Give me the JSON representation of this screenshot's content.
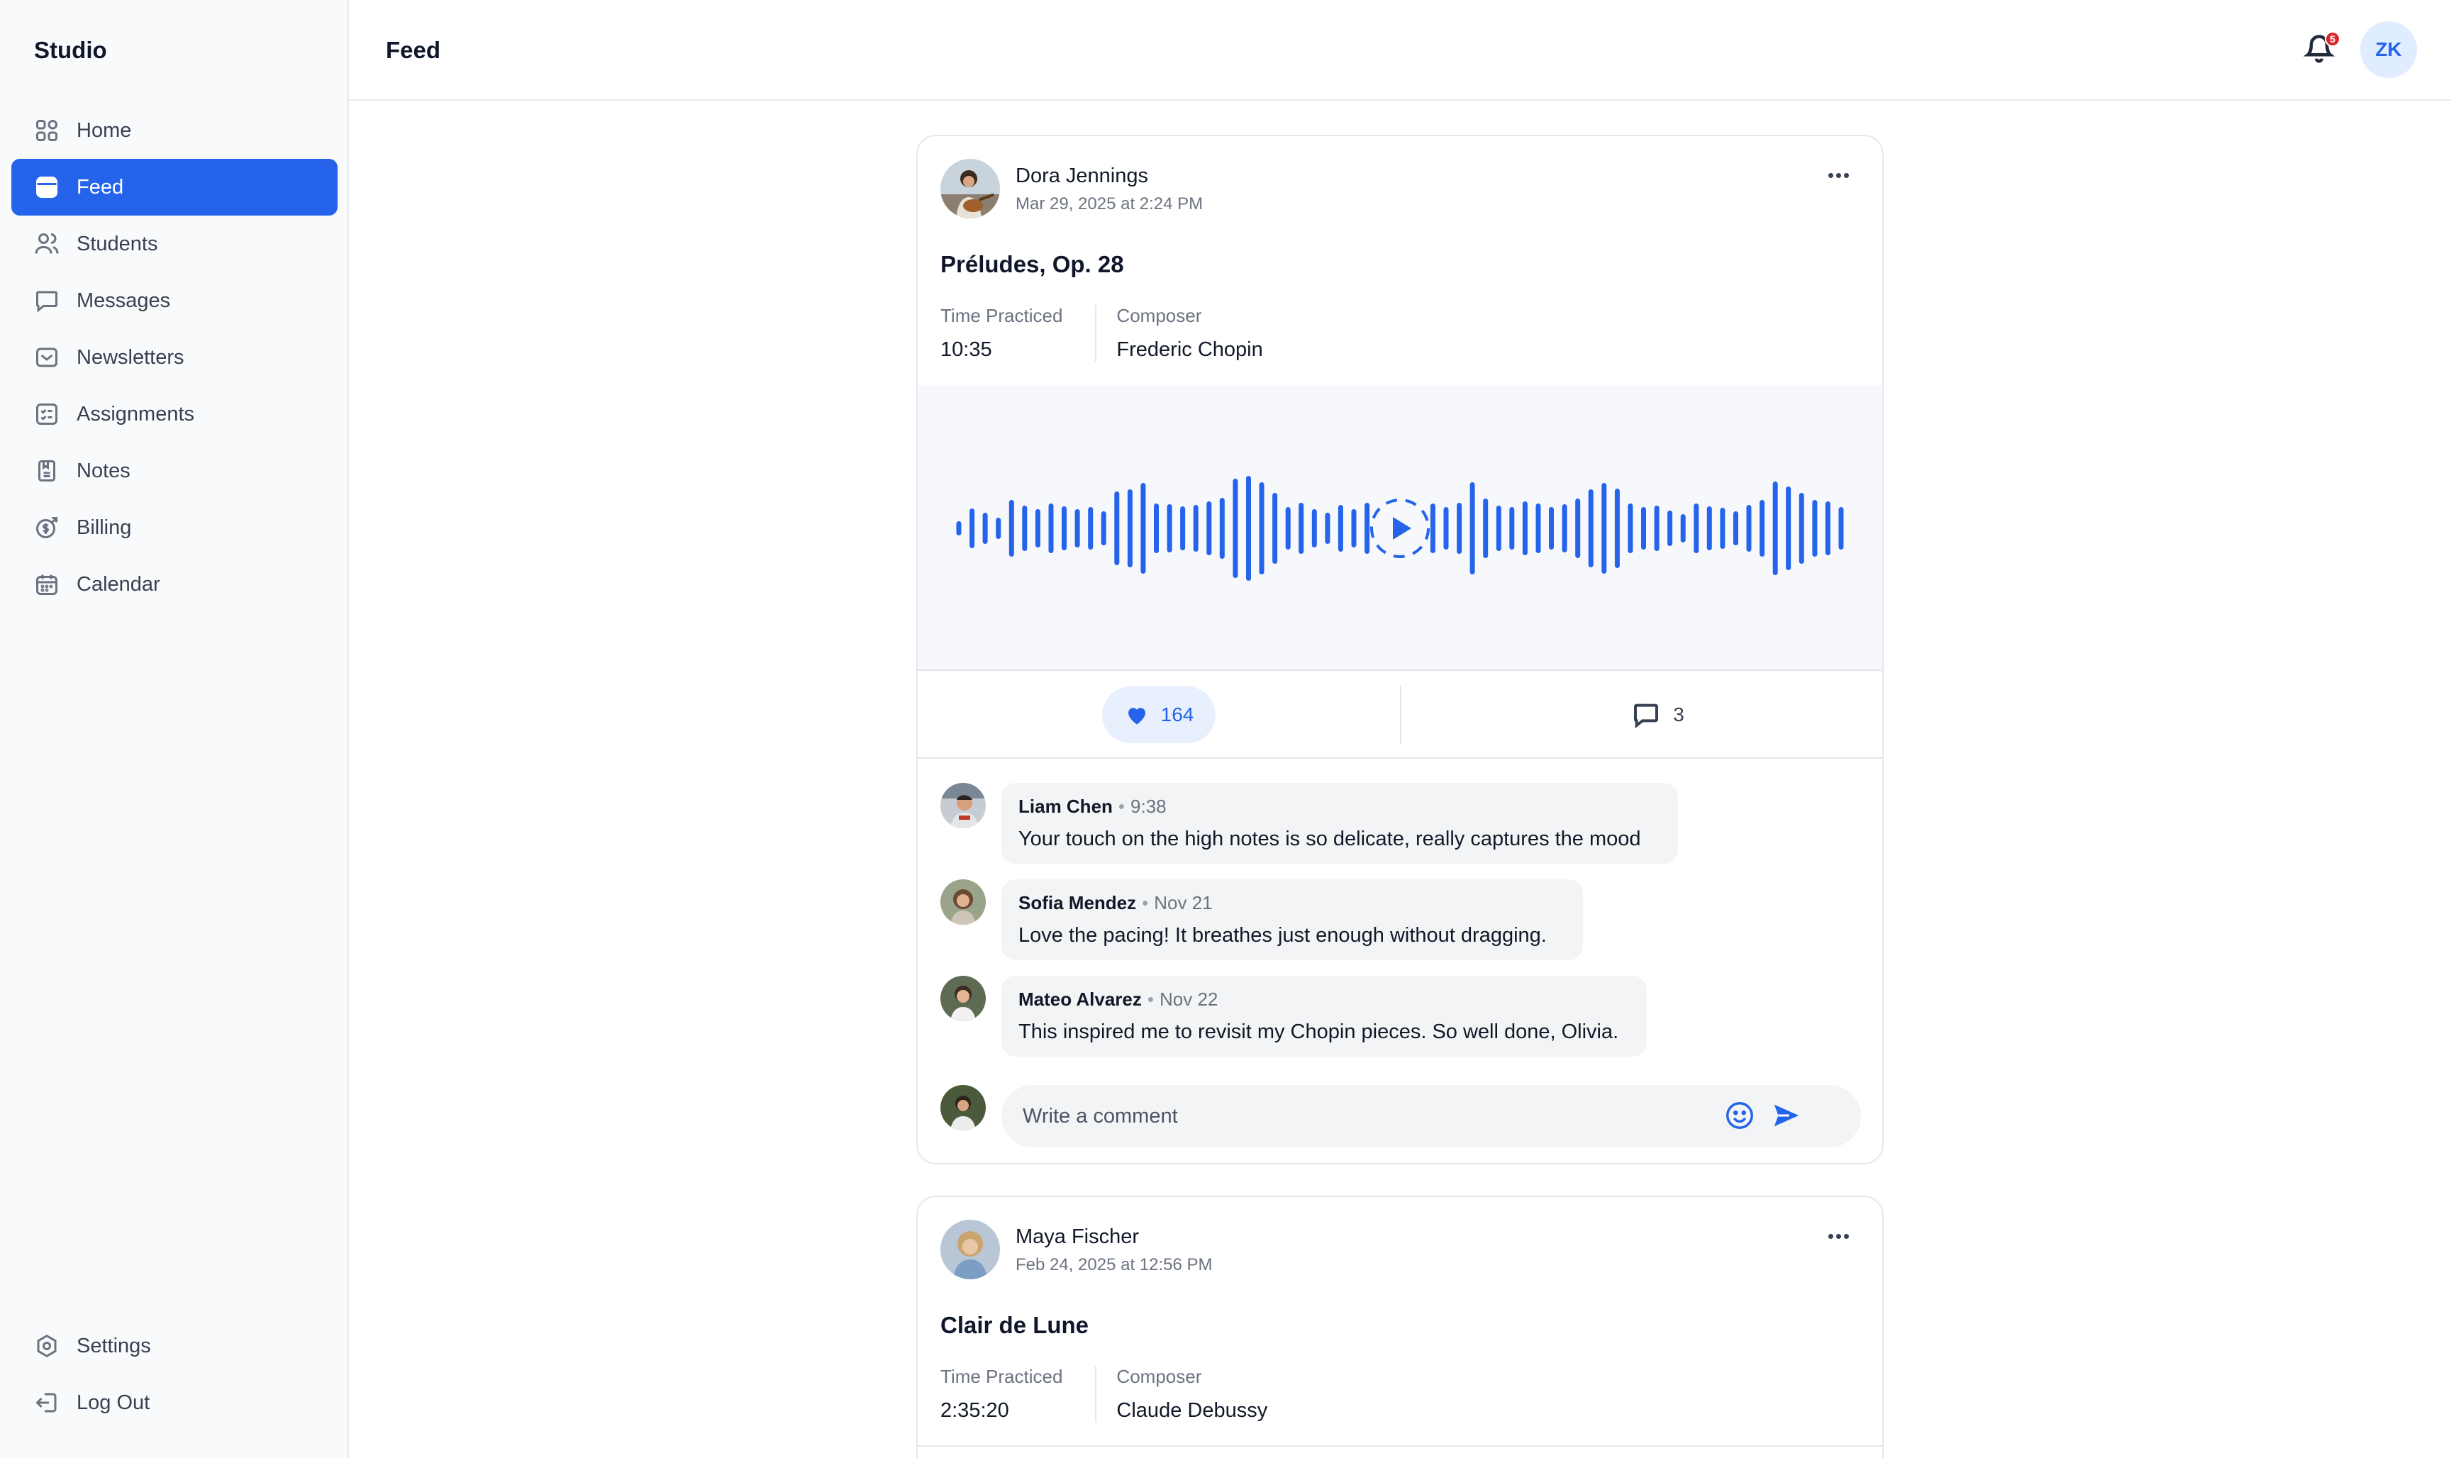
{
  "app": {
    "name": "Studio"
  },
  "nav": {
    "items": [
      {
        "label": "Home",
        "icon": "grid-icon"
      },
      {
        "label": "Feed",
        "icon": "feed-icon",
        "active": true
      },
      {
        "label": "Students",
        "icon": "users-icon"
      },
      {
        "label": "Messages",
        "icon": "chat-icon"
      },
      {
        "label": "Newsletters",
        "icon": "mail-icon"
      },
      {
        "label": "Assignments",
        "icon": "checklist-icon"
      },
      {
        "label": "Notes",
        "icon": "note-icon"
      },
      {
        "label": "Billing",
        "icon": "dollar-icon"
      },
      {
        "label": "Calendar",
        "icon": "calendar-icon"
      }
    ],
    "bottom": [
      {
        "label": "Settings",
        "icon": "gear-icon"
      },
      {
        "label": "Log Out",
        "icon": "logout-icon"
      }
    ]
  },
  "header": {
    "title": "Feed",
    "notification_count": "5",
    "user_initials": "ZK"
  },
  "colors": {
    "accent": "#2563eb",
    "badge": "#dc2626"
  },
  "posts": [
    {
      "author": "Dora Jennings",
      "date": "Mar 29, 2025 at 2:24 PM",
      "title": "Préludes, Op. 28",
      "meta": {
        "time_label": "Time Practiced",
        "time_value": "10:35",
        "composer_label": "Composer",
        "composer_value": "Frederic Chopin"
      },
      "audio_playing": false,
      "likes": "164",
      "comments_count": "3",
      "comments": [
        {
          "name": "Liam Chen",
          "when": "9:38",
          "text": "Your touch on the high notes is so delicate, really captures the mood"
        },
        {
          "name": "Sofia Mendez",
          "when": "Nov 21",
          "text": "Love the pacing! It breathes just enough without dragging."
        },
        {
          "name": "Mateo Alvarez",
          "when": "Nov 22",
          "text": "This inspired me to revisit my Chopin pieces. So well done, Olivia."
        }
      ],
      "composer_placeholder": "Write a comment"
    },
    {
      "author": "Maya Fischer",
      "date": "Feb 24, 2025 at 12:56 PM",
      "title": "Clair de Lune",
      "meta": {
        "time_label": "Time Practiced",
        "time_value": "2:35:20",
        "composer_label": "Composer",
        "composer_value": "Claude Debussy"
      }
    }
  ]
}
